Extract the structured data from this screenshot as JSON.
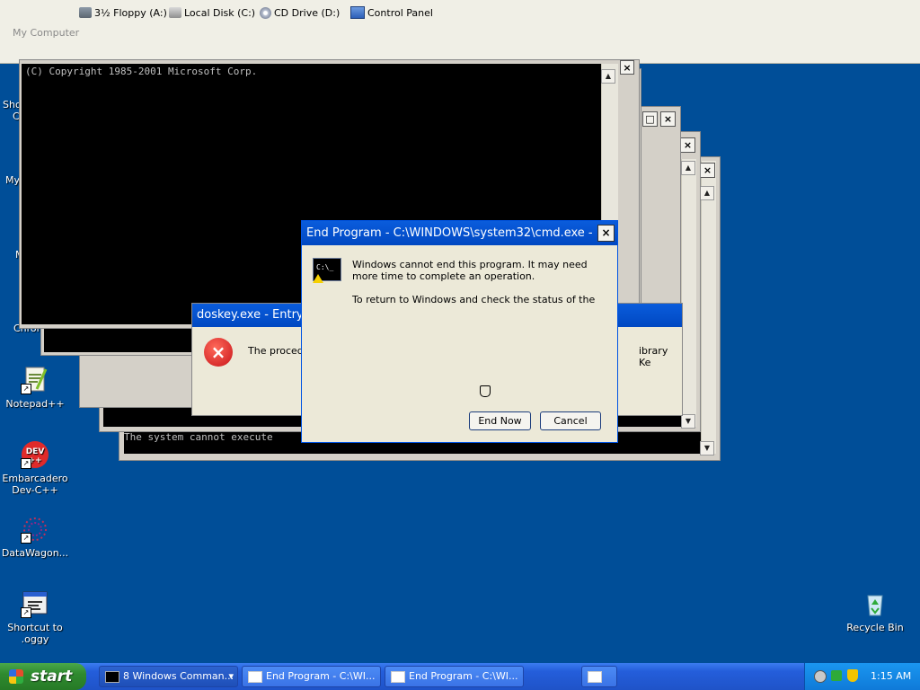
{
  "explorer": {
    "drives": [
      {
        "label": "3½ Floppy (A:)",
        "icon": "floppy-icon"
      },
      {
        "label": "Local Disk (C:)",
        "icon": "hard-disk-icon"
      },
      {
        "label": "CD Drive (D:)",
        "icon": "cd-drive-icon"
      },
      {
        "label": "Control Panel",
        "icon": "control-panel-icon"
      }
    ],
    "location": "My Computer"
  },
  "desktop": {
    "partial_labels": [
      "Sho",
      "C",
      "My",
      "M",
      "Chron"
    ],
    "icons": [
      {
        "label": "Notepad++",
        "icon": "notepad-plus-plus-icon"
      },
      {
        "label": "Embarcadero Dev-C++",
        "icon": "devcpp-icon",
        "badge": "DEV ++"
      },
      {
        "label": "DataWagon...",
        "icon": "datawagon-icon"
      },
      {
        "label": "Shortcut to .oggy",
        "icon": "oggy-shortcut-icon"
      },
      {
        "label": "Recycle Bin",
        "icon": "recycle-bin-icon"
      }
    ]
  },
  "console_windows": {
    "top_text": "(C) Copyright 1985-2001 Microsoft Corp.",
    "back_text": "The system cannot execute"
  },
  "error_dialog": {
    "title": "doskey.exe - Entry",
    "body_fragment": "The procedure",
    "side_text": "ibrary Ke"
  },
  "end_program_dialog": {
    "title": "End Program - C:\\WINDOWS\\system32\\cmd.exe - ...",
    "close": "×",
    "message": "Windows cannot end this program. It may need more time to complete an operation.",
    "message2": "To return to Windows and check the status of the",
    "end_now": "End Now",
    "cancel": "Cancel",
    "icon_text": "C:\\_"
  },
  "taskbar": {
    "start": "start",
    "tasks": [
      {
        "label": "8 Windows Comman...",
        "icon": "cmd-icon",
        "dropdown": "▾"
      },
      {
        "label": "End Program - C:\\WI...",
        "icon": "window-icon"
      },
      {
        "label": "End Program - C:\\WI...",
        "icon": "window-icon"
      },
      {
        "label": "",
        "icon": "window-icon"
      }
    ],
    "clock": "1:15 AM"
  },
  "colors": {
    "desktop": "#004e98",
    "title_active": "#0a5cdc",
    "taskbar": "#245edb",
    "start_green": "#2f8a2f"
  }
}
